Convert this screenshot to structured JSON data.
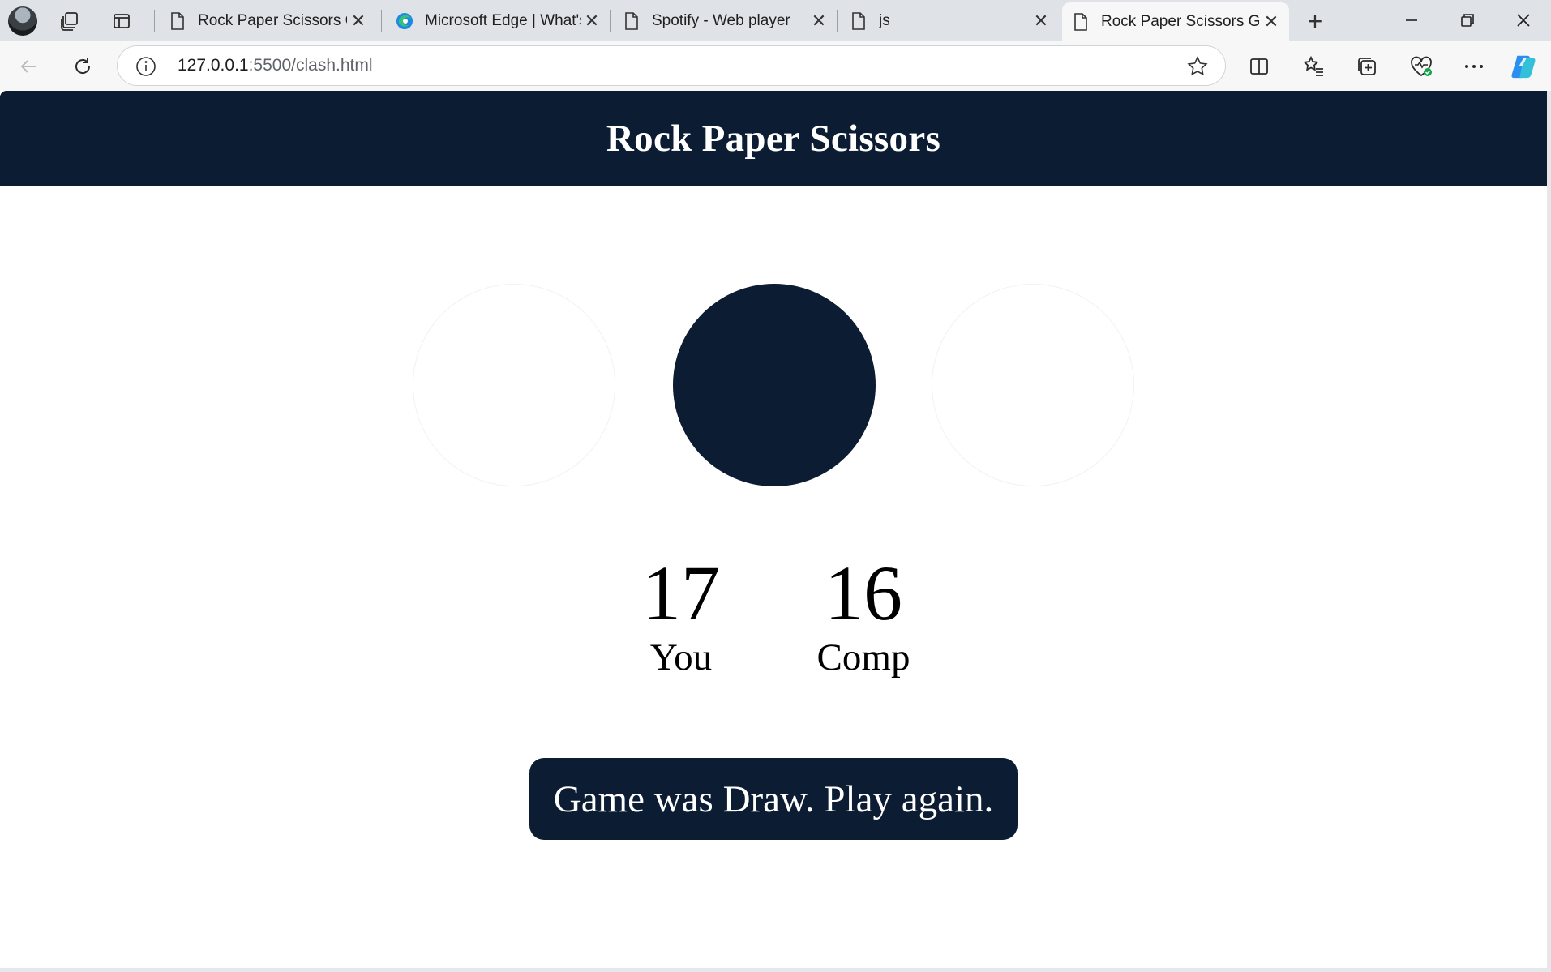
{
  "browser": {
    "tabs": [
      {
        "title": "Rock Paper Scissors Gar",
        "icon": "page-icon",
        "active": false
      },
      {
        "title": "Microsoft Edge | What's",
        "icon": "edge-logo-icon",
        "active": false
      },
      {
        "title": "Spotify - Web player",
        "icon": "page-icon",
        "active": false
      },
      {
        "title": "js",
        "icon": "page-icon",
        "active": false
      },
      {
        "title": "Rock Paper Scissors Gar",
        "icon": "page-icon",
        "active": true
      }
    ],
    "url_host": "127.0.0.1",
    "url_path": ":5500/clash.html",
    "accent_color": "#0b1c33"
  },
  "page": {
    "title": "Rock Paper Scissors",
    "scores": {
      "user": "17",
      "user_label": "You",
      "comp": "16",
      "comp_label": "Comp"
    },
    "message": "Game was Draw. Play again."
  }
}
